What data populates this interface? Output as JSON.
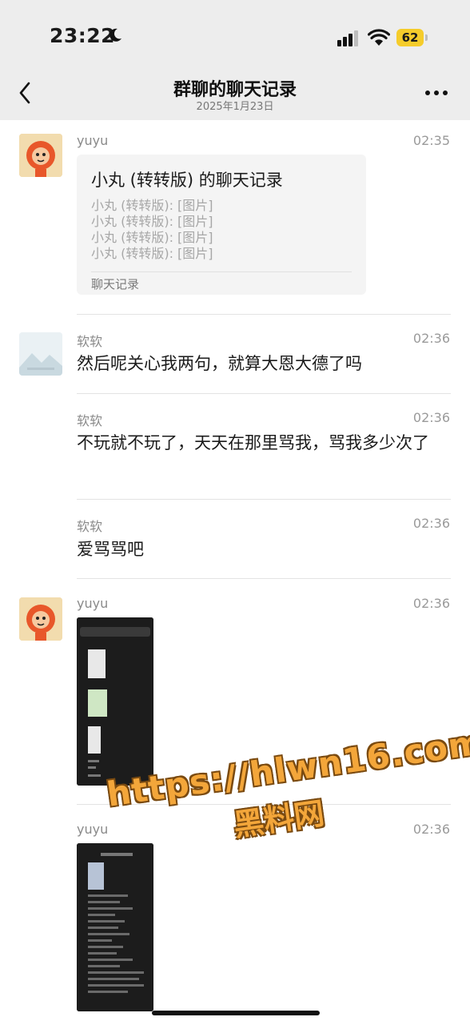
{
  "status_bar": {
    "time": "23:22",
    "battery": "62"
  },
  "nav": {
    "title": "群聊的聊天记录",
    "date": "2025年1月23日"
  },
  "messages": [
    {
      "sender": "yuyu",
      "time": "02:35",
      "type": "chat_record",
      "card": {
        "title": "小丸 (转转版) 的聊天记录",
        "lines": [
          "小丸 (转转版): [图片]",
          "小丸 (转转版): [图片]",
          "小丸 (转转版): [图片]",
          "小丸 (转转版): [图片]"
        ],
        "footer": "聊天记录"
      }
    },
    {
      "sender": "软软",
      "time": "02:36",
      "type": "text",
      "text": "然后呢关心我两句，就算大恩大德了吗"
    },
    {
      "sender": "软软",
      "time": "02:36",
      "type": "text",
      "text": "不玩就不玩了，天天在那里骂我，骂我多少次了"
    },
    {
      "sender": "软软",
      "time": "02:36",
      "type": "text",
      "text": "爱骂骂吧"
    },
    {
      "sender": "yuyu",
      "time": "02:36",
      "type": "image"
    },
    {
      "sender": "yuyu",
      "time": "02:36",
      "type": "image"
    }
  ],
  "watermark": {
    "line1": "https://hlwn16.com",
    "line2": "黑料网"
  },
  "colors": {
    "bar_bg": "#ededed",
    "battery": "#f5cc2b",
    "watermark": "#f3a63a"
  },
  "icons": [
    "moon-icon",
    "signal-icon",
    "wifi-icon",
    "back-icon",
    "more-icon"
  ]
}
